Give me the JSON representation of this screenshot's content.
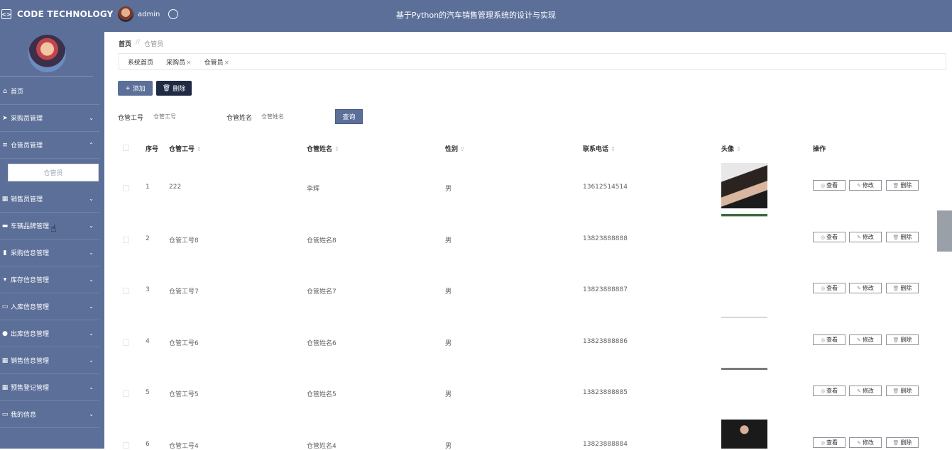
{
  "header": {
    "brand": "CODE TECHNOLOGY",
    "brand_icon": "code-icon",
    "user_name": "admin",
    "site_title": "基于Python的汽车销售管理系统的设计与实现"
  },
  "sidebar": {
    "items": [
      {
        "label": "首页",
        "icon": "home-icon",
        "has_chevron": false
      },
      {
        "label": "采购员管理",
        "icon": "send-icon",
        "has_chevron": true,
        "chevron": "⌄"
      },
      {
        "label": "仓管员管理",
        "icon": "list-icon",
        "has_chevron": true,
        "chevron": "⌃",
        "expanded": true
      },
      {
        "label": "销售员管理",
        "icon": "grid-icon",
        "has_chevron": true,
        "chevron": "⌄"
      },
      {
        "label": "车辆品牌管理",
        "icon": "message-icon",
        "has_chevron": true,
        "chevron": "⌄"
      },
      {
        "label": "采购信息管理",
        "icon": "bar-chart-icon",
        "has_chevron": true,
        "chevron": "⌄"
      },
      {
        "label": "库存信息管理",
        "icon": "flag-icon",
        "has_chevron": true,
        "chevron": "⌄"
      },
      {
        "label": "入库信息管理",
        "icon": "monitor-icon",
        "has_chevron": true,
        "chevron": "⌄"
      },
      {
        "label": "出库信息管理",
        "icon": "user-icon",
        "has_chevron": true,
        "chevron": "⌄"
      },
      {
        "label": "销售信息管理",
        "icon": "grid-icon",
        "has_chevron": true,
        "chevron": "⌄"
      },
      {
        "label": "预售登记管理",
        "icon": "grid-icon",
        "has_chevron": true,
        "chevron": "⌄"
      },
      {
        "label": "我的信息",
        "icon": "card-icon",
        "has_chevron": true,
        "chevron": "⌄"
      }
    ],
    "submenu_active": "仓管员"
  },
  "breadcrumb": {
    "home": "首页",
    "sep": "//",
    "current": "仓管员"
  },
  "tabs": [
    {
      "label": "系统首页",
      "closable": false
    },
    {
      "label": "采购员",
      "closable": true
    },
    {
      "label": "仓管员",
      "closable": true
    }
  ],
  "tab_close": "×",
  "toolbar": {
    "add_icon": "+",
    "add_label": "添加",
    "delete_icon": "🗑",
    "delete_label": "删除"
  },
  "search": {
    "field1_label": "仓管工号",
    "field1_placeholder": "仓管工号",
    "field2_label": "仓管姓名",
    "field2_placeholder": "仓管姓名",
    "button": "查询"
  },
  "table": {
    "columns": [
      "序号",
      "仓管工号",
      "仓管姓名",
      "性别",
      "联系电话",
      "头像",
      "操作"
    ],
    "sort_glyph": "⇕",
    "rows": [
      {
        "index": "1",
        "code": "222",
        "name": "李辉",
        "gender": "男",
        "phone": "13612514514"
      },
      {
        "index": "2",
        "code": "仓管工号8",
        "name": "仓管姓名8",
        "gender": "男",
        "phone": "13823888888"
      },
      {
        "index": "3",
        "code": "仓管工号7",
        "name": "仓管姓名7",
        "gender": "男",
        "phone": "13823888887"
      },
      {
        "index": "4",
        "code": "仓管工号6",
        "name": "仓管姓名6",
        "gender": "男",
        "phone": "13823888886"
      },
      {
        "index": "5",
        "code": "仓管工号5",
        "name": "仓管姓名5",
        "gender": "男",
        "phone": "13823888885"
      },
      {
        "index": "6",
        "code": "仓管工号4",
        "name": "仓管姓名4",
        "gender": "男",
        "phone": "13823888884"
      }
    ],
    "actions": {
      "view": "查看",
      "edit": "修改",
      "delete": "删除",
      "view_icon": "◎",
      "edit_icon": "✎",
      "delete_icon": "🗑"
    }
  },
  "colors": {
    "primary": "#5b6f98",
    "dark_button": "#1f2a44"
  }
}
